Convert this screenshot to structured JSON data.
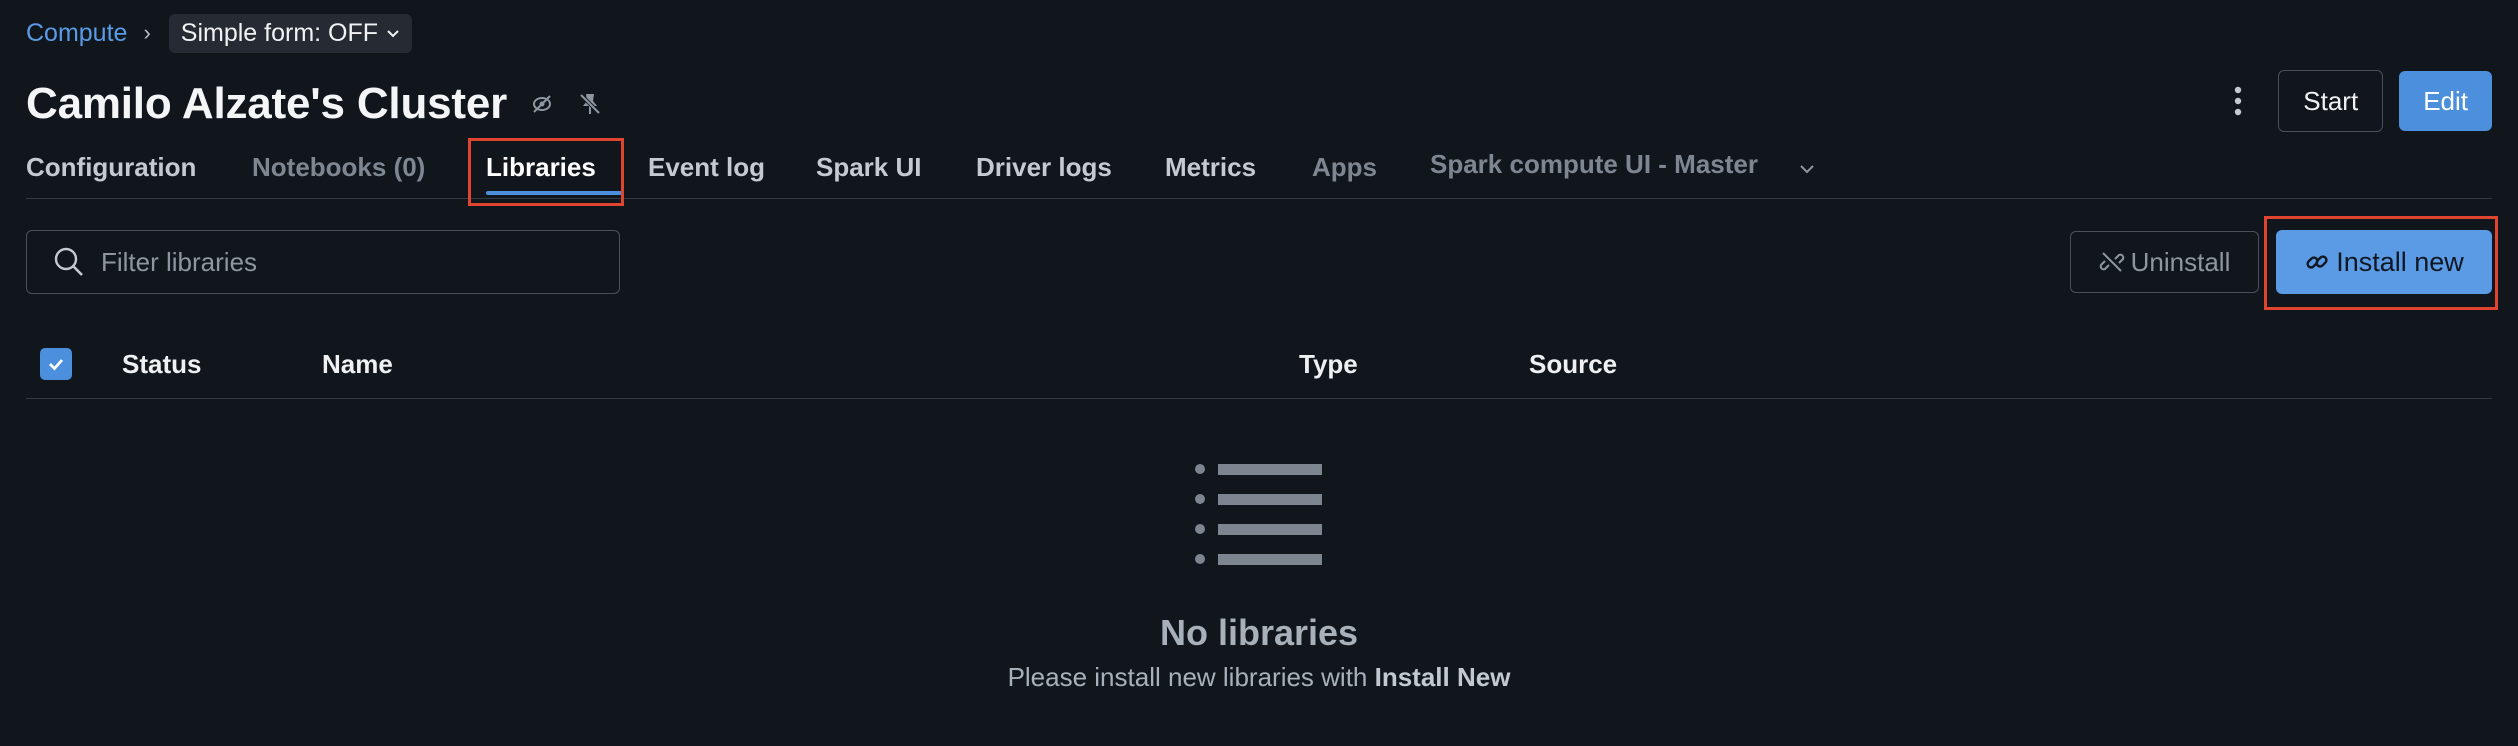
{
  "breadcrumb": {
    "root": "Compute",
    "separator": "›",
    "simple_form": "Simple form: OFF"
  },
  "header": {
    "title": "Camilo Alzate's Cluster",
    "start_label": "Start",
    "edit_label": "Edit"
  },
  "tabs": [
    {
      "label": "Configuration"
    },
    {
      "label": "Notebooks (0)"
    },
    {
      "label": "Libraries"
    },
    {
      "label": "Event log"
    },
    {
      "label": "Spark UI"
    },
    {
      "label": "Driver logs"
    },
    {
      "label": "Metrics"
    },
    {
      "label": "Apps"
    },
    {
      "label": "Spark compute UI - Master"
    }
  ],
  "active_tab": "Libraries",
  "toolbar": {
    "filter_placeholder": "Filter libraries",
    "uninstall_label": "Uninstall",
    "install_label": "Install new"
  },
  "table": {
    "columns": [
      "Status",
      "Name",
      "Type",
      "Source"
    ],
    "select_all_checked": true
  },
  "empty_state": {
    "title": "No libraries",
    "description_prefix": "Please install new libraries with ",
    "description_emphasis": "Install New"
  },
  "colors": {
    "background": "#11161d",
    "accent": "#4c8fdc",
    "highlight": "#e0452f"
  }
}
